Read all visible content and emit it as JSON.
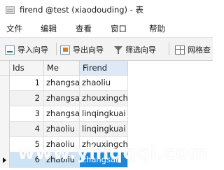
{
  "window": {
    "title": "firend @test (xiaodouding) - 表",
    "icon": "table-icon"
  },
  "menu": {
    "items": [
      {
        "label": "文件"
      },
      {
        "label": "编辑"
      },
      {
        "label": "查看"
      },
      {
        "label": "窗口"
      },
      {
        "label": "帮助"
      }
    ]
  },
  "toolbar": {
    "import_label": "导入向导",
    "export_label": "导出向导",
    "filter_label": "筛选向导",
    "grid_label": "网格查"
  },
  "table": {
    "columns": [
      "Ids",
      "Me",
      "Firend"
    ],
    "active_column": "Firend",
    "rows": [
      {
        "id": "1",
        "me": "zhangsan",
        "friend": "zhaoliu"
      },
      {
        "id": "2",
        "me": "zhangsan",
        "friend": "zhouxingchi"
      },
      {
        "id": "3",
        "me": "zhangsan",
        "friend": "linqingkuai"
      },
      {
        "id": "4",
        "me": "zhaoliu",
        "friend": "linqingkuai"
      },
      {
        "id": "5",
        "me": "zhaoliu",
        "friend": "zhouxingchi"
      },
      {
        "id": "6",
        "me": "zhaoliu",
        "friend": "zhangsan"
      }
    ],
    "current_row": 6
  },
  "watermark": {
    "text": "www.yinqqqi.com"
  },
  "colors": {
    "selection": "#1c86d8",
    "column_highlight": "#dde9f7",
    "row_highlight": "#cfe3f7"
  }
}
